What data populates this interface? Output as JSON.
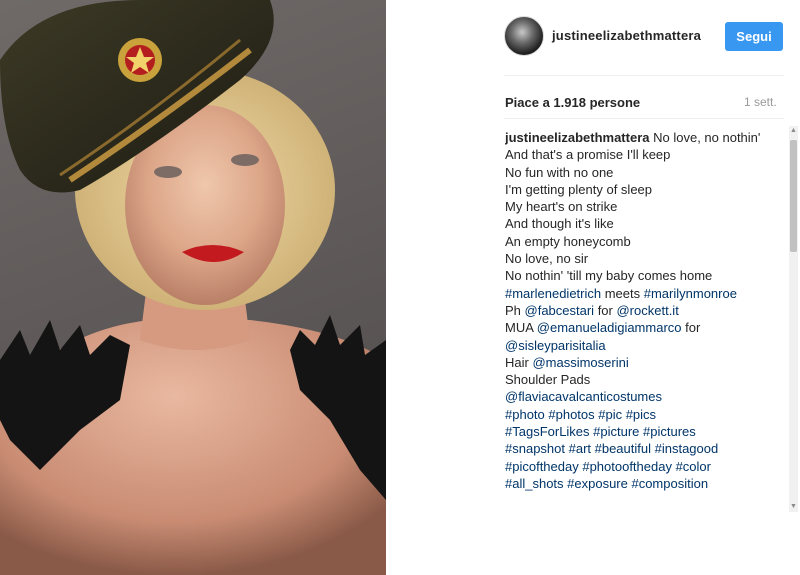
{
  "post": {
    "username": "justineelizabethmattera",
    "follow_label": "Segui",
    "likes_text": "Piace a 1.918 persone",
    "time_ago": "1 sett."
  },
  "caption": {
    "owner": "justineelizabethmattera",
    "first_text": " No love, no nothin'",
    "l2": "And that's a promise I'll keep",
    "l3": "No fun with no one",
    "l4": "I'm getting plenty of sleep",
    "l5": "My heart's on strike",
    "l6": "And though it's like",
    "l7": "An empty honeycomb",
    "l8": "No love, no sir",
    "l9": "No nothin' 'till my baby comes home",
    "l10_tag1": "#marlenedietrich",
    "l10_mid": " meets ",
    "l10_tag2": "#marilynmonroe",
    "l11_pre": "Ph ",
    "l11_tag1": "@fabcestari",
    "l11_mid": " for ",
    "l11_tag2": "@rockett.it",
    "l12_pre": "MUA ",
    "l12_tag": "@emanueladigiammarco",
    "l12_post": " for",
    "l13_tag": "@sisleyparisitalia",
    "l14_pre": "Hair ",
    "l14_tag": "@massimoserini",
    "l15": "Shoulder Pads",
    "l16_tag": "@flaviacavalcanticostumes",
    "l17": "#photo #photos #pic #pics",
    "l18": "#TagsForLikes #picture #pictures",
    "l19": "#snapshot #art #beautiful #instagood",
    "l20": "#picoftheday #photooftheday #color",
    "l21": "#all_shots #exposure #composition"
  },
  "colors": {
    "follow_button": "#3897f0",
    "link": "#003569",
    "muted": "#999999"
  },
  "icons": {
    "photo": "portrait-photo",
    "avatar": "profile-avatar"
  }
}
